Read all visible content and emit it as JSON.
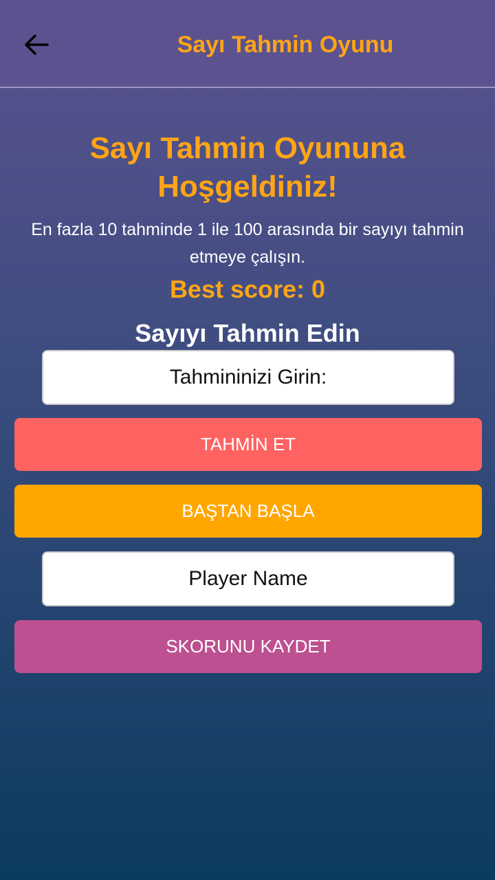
{
  "app_bar": {
    "title": "Sayı Tahmin Oyunu",
    "back_icon": "arrow-left-icon"
  },
  "main": {
    "welcome": "Sayı Tahmin Oyununa Hoşgeldiniz!",
    "instructions": "En fazla 10 tahminde 1 ile 100 arasında bir sayıyı tahmin etmeye çalışın.",
    "best_score": "Best score: 0",
    "guess_heading": "Sayıyı Tahmin Edin",
    "guess_input": {
      "placeholder": "Tahmininizi Girin:",
      "value": ""
    },
    "guess_button": "TAHMİN ET",
    "restart_button": "BAŞTAN BAŞLA",
    "name_input": {
      "placeholder": "Player Name",
      "value": ""
    },
    "save_button": "SKORUNU KAYDET"
  },
  "colors": {
    "accent_orange": "#ffa516",
    "guess_button": "#ff6361",
    "restart_button": "#ffa600",
    "save_button": "#bc5090",
    "app_bar": "#5b528f",
    "gradient_bottom": "#0b3b5d"
  }
}
